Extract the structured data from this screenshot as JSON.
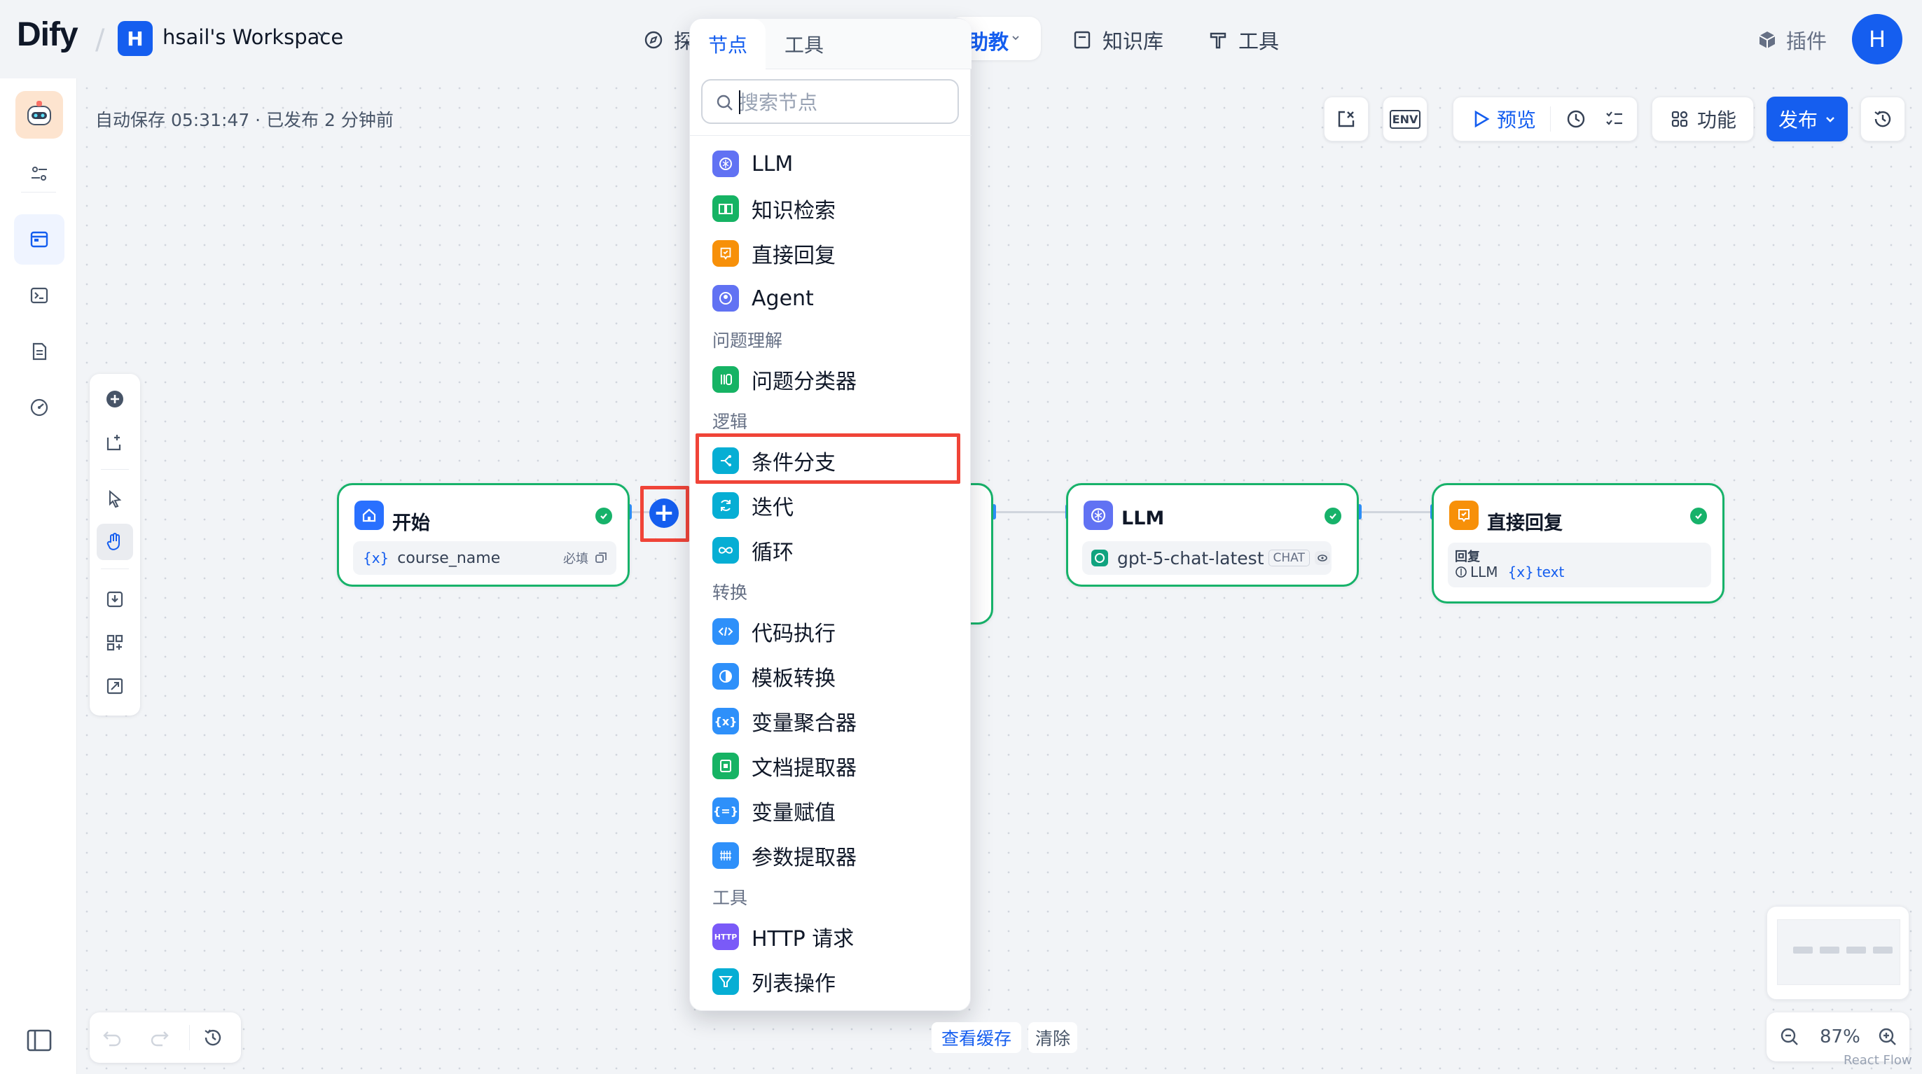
{
  "header": {
    "logo": "Dify",
    "workspace_initial": "H",
    "workspace_name": "hsail's Workspace",
    "nav": {
      "explore_partial": "探",
      "studio_partial": "助教",
      "knowledge": "知识库",
      "tools": "工具"
    },
    "plugin": "插件",
    "avatar_initial": "H"
  },
  "canvas": {
    "autosave": "自动保存 05:31:47 · 已发布 2 分钟前",
    "toolbar": {
      "env": "ENV",
      "preview": "预览",
      "features": "功能",
      "publish": "发布"
    }
  },
  "nodes": {
    "start": {
      "title": "开始",
      "var_prefix": "{x}",
      "var_name": "course_name",
      "required": "必填"
    },
    "llm": {
      "title": "LLM",
      "model": "gpt-5-chat-latest",
      "model_tag": "CHAT"
    },
    "reply": {
      "title": "直接回复",
      "label": "回复",
      "ref_node": "LLM",
      "ref_var_prefix": "{x}",
      "ref_var": "text"
    }
  },
  "node_picker": {
    "tabs": [
      "节点",
      "工具"
    ],
    "search_placeholder": "搜索节点",
    "items_top": [
      "LLM",
      "知识检索",
      "直接回复",
      "Agent"
    ],
    "group_qu": "问题理解",
    "items_qu": [
      "问题分类器"
    ],
    "group_logic": "逻辑",
    "items_logic": [
      "条件分支",
      "迭代",
      "循环"
    ],
    "group_transform": "转换",
    "items_transform": [
      "代码执行",
      "模板转换",
      "变量聚合器",
      "文档提取器",
      "变量赋值",
      "参数提取器"
    ],
    "group_tools": "工具",
    "items_tools": [
      "HTTP 请求",
      "列表操作"
    ],
    "http_badge": "HTTP"
  },
  "bottom": {
    "view_cache": "查看缓存",
    "clear": "清除",
    "zoom": "87%",
    "react_flow": "React Flow"
  },
  "colors": {
    "primary": "#155eef",
    "node_border": "#17b26a",
    "highlight": "#f04438"
  }
}
